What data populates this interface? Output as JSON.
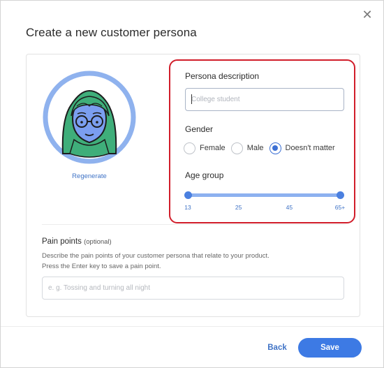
{
  "dialog": {
    "title": "Create a new customer persona",
    "close_icon": "close-icon",
    "close_symbol": "✕"
  },
  "avatar": {
    "icon": "persona-avatar-icon",
    "regenerate_label": "Regenerate"
  },
  "persona": {
    "label": "Persona description",
    "placeholder": "College student",
    "value": ""
  },
  "gender": {
    "label": "Gender",
    "options": [
      {
        "label": "Female",
        "checked": false
      },
      {
        "label": "Male",
        "checked": false
      },
      {
        "label": "Doesn't matter",
        "checked": true
      }
    ]
  },
  "age_group": {
    "label": "Age group",
    "min": 13,
    "max": 65,
    "selected_min": 13,
    "selected_max": 65,
    "ticks": [
      "13",
      "25",
      "45",
      "65+"
    ]
  },
  "pain_points": {
    "label": "Pain points",
    "optional_text": "(optional)",
    "description_line1": "Describe the pain points of your customer persona that relate to your product.",
    "description_line2": "Press the Enter key to save a pain point.",
    "placeholder": "e. g. Tossing and turning all night",
    "value": ""
  },
  "footer": {
    "back_label": "Back",
    "save_label": "Save"
  },
  "colors": {
    "accent": "#3d7ae4",
    "highlight_border": "#d11d2a",
    "link": "#3f73c6"
  }
}
